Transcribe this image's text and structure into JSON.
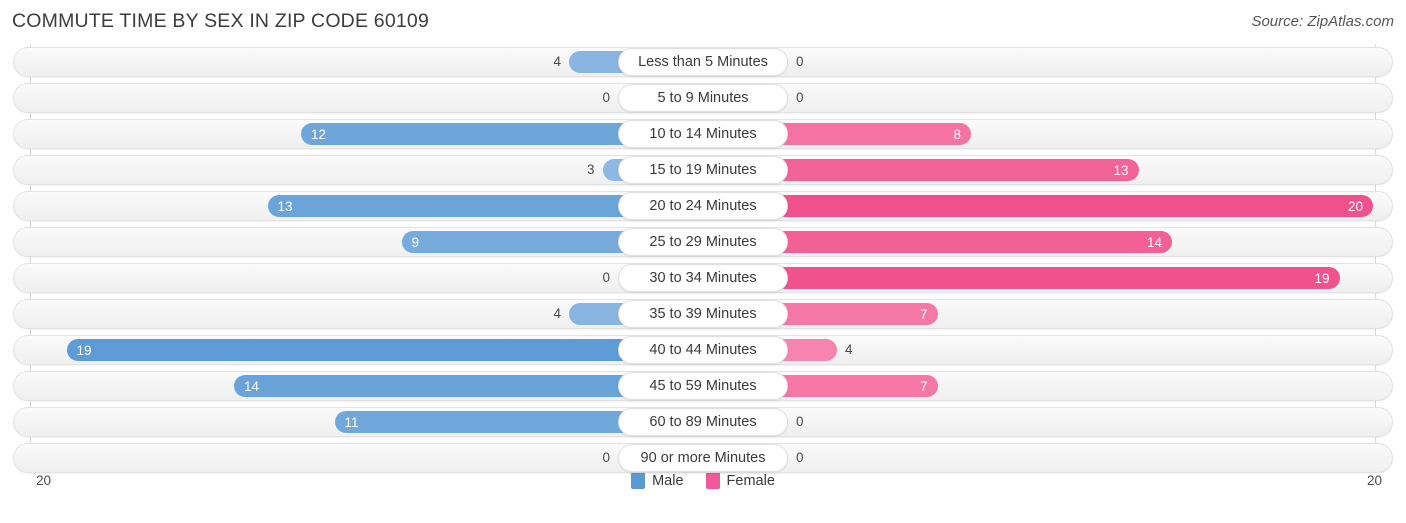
{
  "header": {
    "title": "COMMUTE TIME BY SEX IN ZIP CODE 60109",
    "source": "Source: ZipAtlas.com"
  },
  "legend": {
    "male_label": "Male",
    "female_label": "Female",
    "male_color": "#5B9BD5",
    "female_color": "#F2599C"
  },
  "axis": {
    "left_max": "20",
    "right_max": "20"
  },
  "chart_data": {
    "type": "bar",
    "title": "COMMUTE TIME BY SEX IN ZIP CODE 60109",
    "subtitle": "Source: ZipAtlas.com",
    "orientation": "horizontal-diverging",
    "xlabel": "",
    "ylabel": "",
    "xlim": [
      20,
      20
    ],
    "grid": true,
    "legend_position": "bottom-center",
    "categories": [
      "Less than 5 Minutes",
      "5 to 9 Minutes",
      "10 to 14 Minutes",
      "15 to 19 Minutes",
      "20 to 24 Minutes",
      "25 to 29 Minutes",
      "30 to 34 Minutes",
      "35 to 39 Minutes",
      "40 to 44 Minutes",
      "45 to 59 Minutes",
      "60 to 89 Minutes",
      "90 or more Minutes"
    ],
    "series": [
      {
        "name": "Male",
        "values": [
          4,
          0,
          12,
          3,
          13,
          9,
          0,
          4,
          19,
          14,
          11,
          0
        ]
      },
      {
        "name": "Female",
        "values": [
          0,
          0,
          8,
          13,
          20,
          14,
          19,
          7,
          4,
          7,
          0,
          0
        ]
      }
    ]
  }
}
